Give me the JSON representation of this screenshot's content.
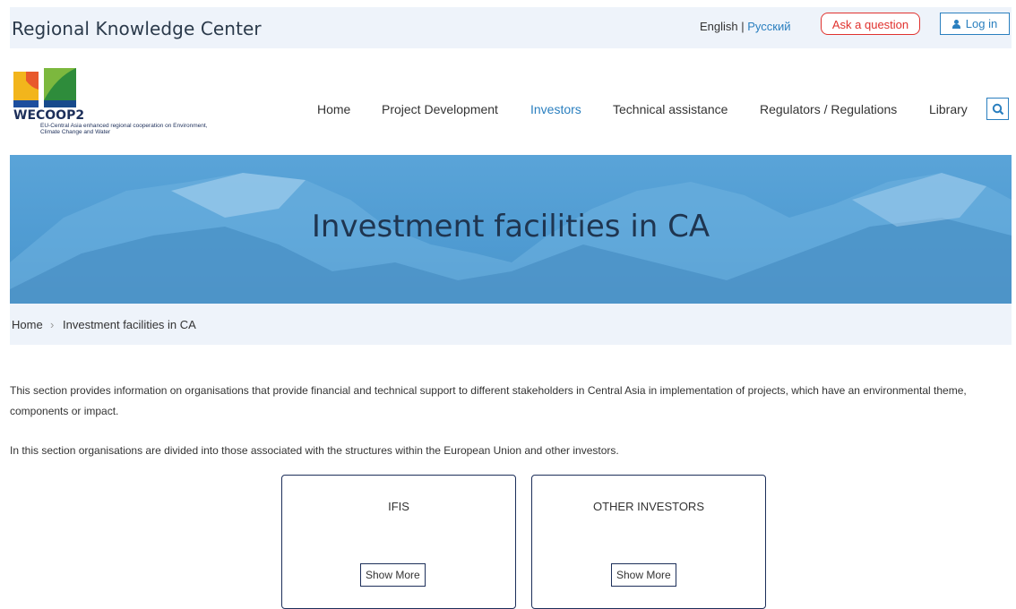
{
  "header": {
    "site_title": "Regional Knowledge Center",
    "lang_en": "English",
    "lang_sep": " | ",
    "lang_ru": "Русский",
    "ask_label": "Ask a question",
    "login_label": "Log in"
  },
  "logo": {
    "name": "WECOOP2",
    "subtitle": "EU-Central Asia enhanced regional cooperation on Environment, Climate Change and Water"
  },
  "nav": {
    "items": [
      {
        "label": "Home"
      },
      {
        "label": "Project Development"
      },
      {
        "label": "Investors"
      },
      {
        "label": "Technical assistance"
      },
      {
        "label": "Regulators / Regulations"
      },
      {
        "label": "Library"
      }
    ],
    "active": "Investors",
    "search_icon": "search-icon"
  },
  "hero": {
    "title": "Investment facilities in CA"
  },
  "breadcrumb": {
    "home": "Home",
    "separator": "›",
    "current": "Investment facilities in CA"
  },
  "content": {
    "paragraph1": "This section provides information on organisations that provide financial and technical support to different stakeholders in Central Asia in implementation of projects, which have an environmental theme, components or impact.",
    "paragraph2": "In this section organisations are divided into those associated with the structures within the European Union and other investors."
  },
  "cards": [
    {
      "title": "IFIS",
      "button": "Show More"
    },
    {
      "title": "OTHER INVESTORS",
      "button": "Show More"
    }
  ],
  "colors": {
    "accent": "#2a7fbf",
    "ask_red": "#e0322e",
    "header_bg": "#eef3fa",
    "hero_blue": "#4f9bd2",
    "navy": "#1d2f5a"
  }
}
